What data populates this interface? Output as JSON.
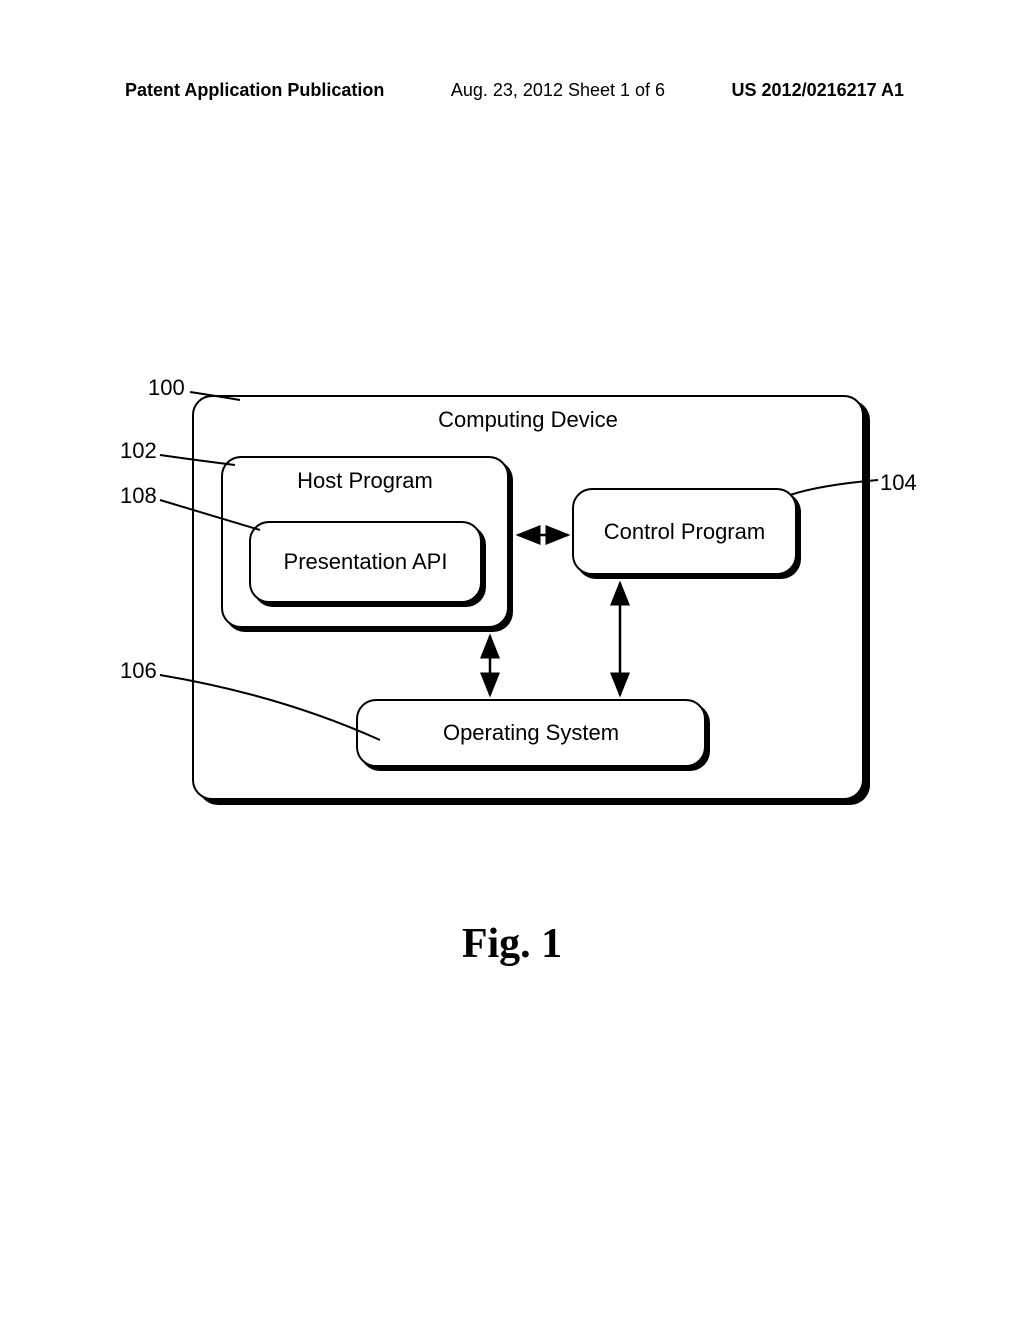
{
  "header": {
    "left": "Patent Application Publication",
    "center": "Aug. 23, 2012  Sheet 1 of 6",
    "right": "US 2012/0216217 A1"
  },
  "boxes": {
    "computing_device": "Computing Device",
    "host_program": "Host Program",
    "presentation_api": "Presentation API",
    "control_program": "Control Program",
    "operating_system": "Operating System"
  },
  "refs": {
    "r100": "100",
    "r102": "102",
    "r108": "108",
    "r106": "106",
    "r104": "104"
  },
  "caption": "Fig. 1"
}
